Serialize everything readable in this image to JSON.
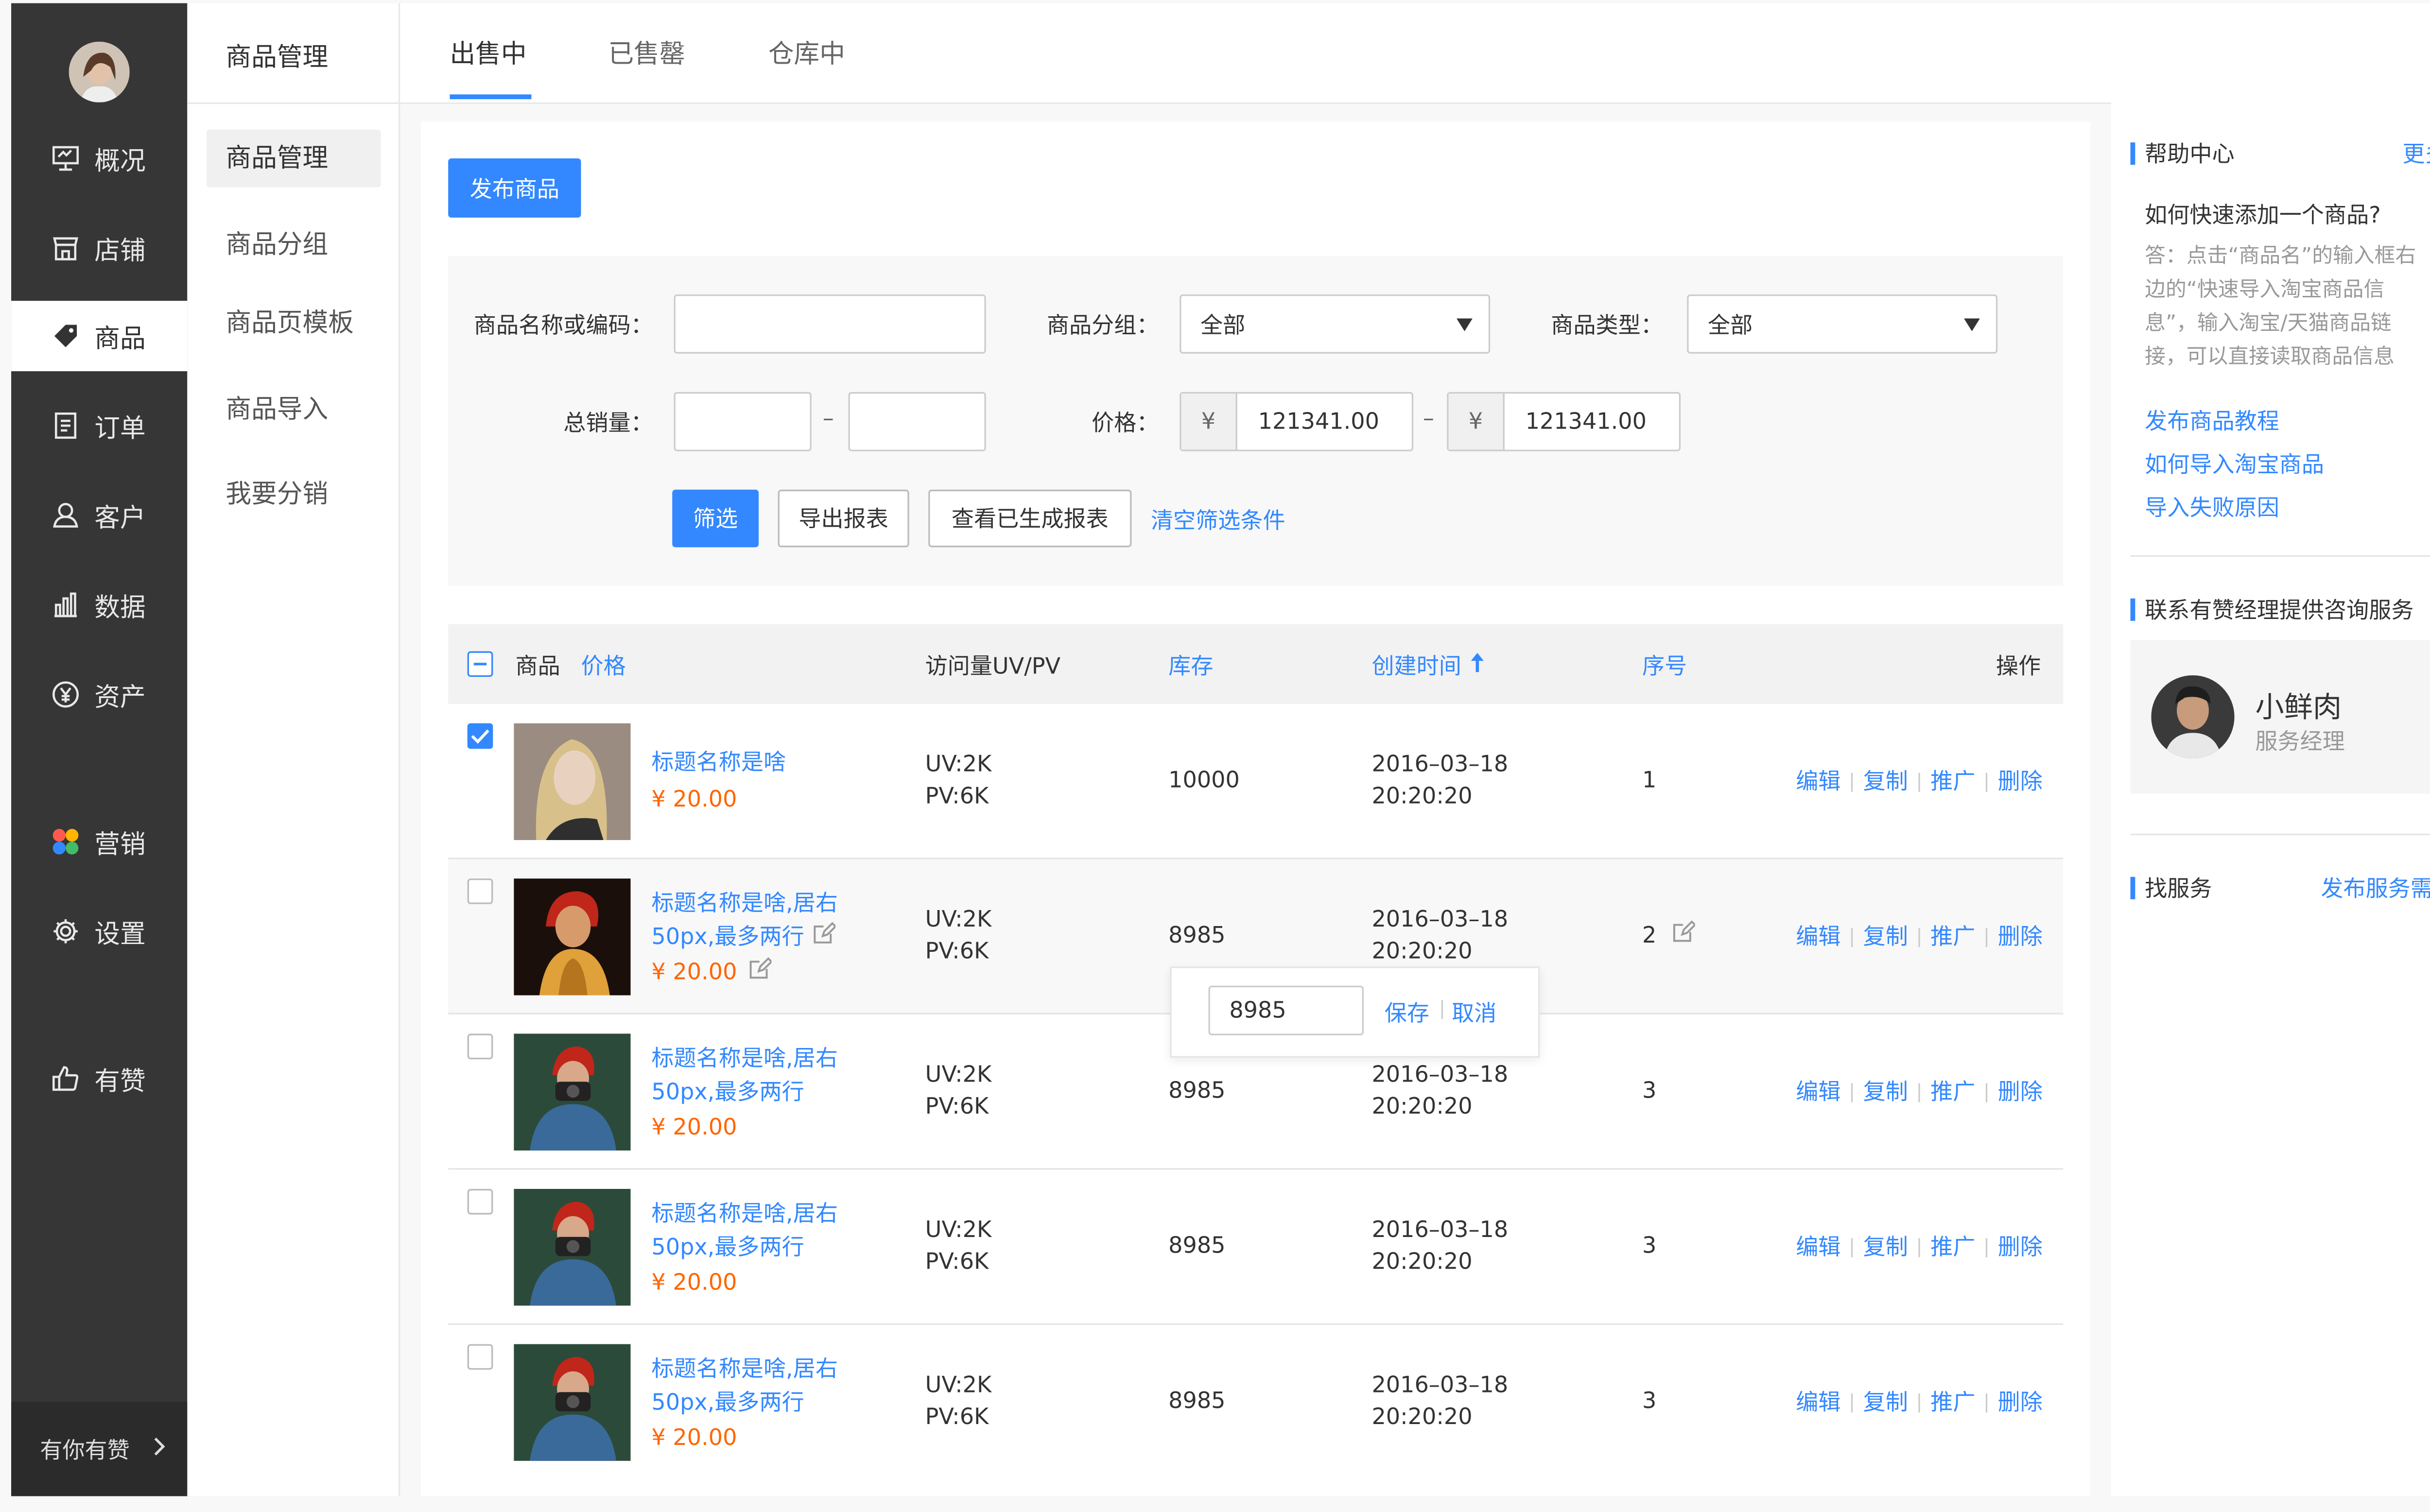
{
  "nav": {
    "items": [
      {
        "label": "概况",
        "icon": "dashboard-icon"
      },
      {
        "label": "店铺",
        "icon": "shop-icon"
      },
      {
        "label": "商品",
        "icon": "tag-icon"
      },
      {
        "label": "订单",
        "icon": "order-icon"
      },
      {
        "label": "客户",
        "icon": "customer-icon"
      },
      {
        "label": "数据",
        "icon": "chart-icon"
      },
      {
        "label": "资产",
        "icon": "yen-icon"
      },
      {
        "label": "营销",
        "icon": "marketing-icon"
      },
      {
        "label": "设置",
        "icon": "gear-icon"
      },
      {
        "label": "有赞",
        "icon": "thumbs-up-icon"
      }
    ],
    "bottom_label": "有你有赞",
    "bottom_icon": "chevron-right-icon"
  },
  "subnav": {
    "title": "商品管理",
    "items": [
      {
        "label": "商品管理"
      },
      {
        "label": "商品分组"
      },
      {
        "label": "商品页模板"
      },
      {
        "label": "商品导入"
      },
      {
        "label": "我要分销"
      }
    ]
  },
  "tabs": [
    {
      "label": "出售中"
    },
    {
      "label": "已售罄"
    },
    {
      "label": "仓库中"
    }
  ],
  "toolbar": {
    "publish_label": "发布商品"
  },
  "filter": {
    "name_label": "商品名称或编码：",
    "name_value": "",
    "group_label": "商品分组：",
    "group_value": "全部",
    "type_label": "商品类型：",
    "type_value": "全部",
    "sales_label": "总销量：",
    "sales_from": "",
    "sales_to": "",
    "range_sep": "–",
    "price_label": "价格：",
    "currency": "¥",
    "price_from": "121341.00",
    "price_to": "121341.00",
    "filter_btn": "筛选",
    "export_btn": "导出报表",
    "view_reports_btn": "查看已生成报表",
    "clear_link": "清空筛选条件"
  },
  "table": {
    "headers": {
      "product": "商品",
      "price": "价格",
      "visits": "访问量UV/PV",
      "stock": "库存",
      "created": "创建时间",
      "sort": "序号",
      "actions": "操作"
    },
    "actions": [
      "编辑",
      "复制",
      "推广",
      "删除"
    ],
    "rows": [
      {
        "checked": true,
        "title1": "标题名称是啥",
        "title2": "",
        "price": "¥ 20.00",
        "uv": "UV:2K",
        "pv": "PV:6K",
        "stock": "10000",
        "date": "2016–03–18",
        "time": "20:20:20",
        "sort": "1"
      },
      {
        "checked": false,
        "title1": "标题名称是啥,居右",
        "title2": "50px,最多两行",
        "price": "¥ 20.00",
        "uv": "UV:2K",
        "pv": "PV:6K",
        "stock": "8985",
        "date": "2016–03–18",
        "time": "20:20:20",
        "sort": "2"
      },
      {
        "checked": false,
        "title1": "标题名称是啥,居右",
        "title2": "50px,最多两行",
        "price": "¥ 20.00",
        "uv": "UV:2K",
        "pv": "PV:6K",
        "stock": "8985",
        "date": "2016–03–18",
        "time": "20:20:20",
        "sort": "3"
      },
      {
        "checked": false,
        "title1": "标题名称是啥,居右",
        "title2": "50px,最多两行",
        "price": "¥ 20.00",
        "uv": "UV:2K",
        "pv": "PV:6K",
        "stock": "8985",
        "date": "2016–03–18",
        "time": "20:20:20",
        "sort": "3"
      },
      {
        "checked": false,
        "title1": "标题名称是啥,居右",
        "title2": "50px,最多两行",
        "price": "¥ 20.00",
        "uv": "UV:2K",
        "pv": "PV:6K",
        "stock": "8985",
        "date": "2016–03–18",
        "time": "20:20:20",
        "sort": "3"
      }
    ]
  },
  "stock_editor": {
    "value": "8985",
    "save": "保存",
    "cancel": "取消"
  },
  "help": {
    "title": "帮助中心",
    "more": "更多",
    "question": "如何快速添加一个商品?",
    "answer_lines": [
      "答：点击“商品名”的输入框右",
      "边的“快速导入淘宝商品信",
      "息”，输入淘宝/天猫商品链",
      "接，可以直接读取商品信息"
    ],
    "links": [
      "发布商品教程",
      "如何导入淘宝商品",
      "导入失败原因"
    ]
  },
  "manager": {
    "title": "联系有赞经理提供咨询服务",
    "name": "小鲜肉",
    "role": "服务经理"
  },
  "service": {
    "title": "找服务",
    "link": "发布服务需求"
  },
  "colors": {
    "accent": "#3388ff",
    "price": "#ff6600",
    "nav_bg": "#363636"
  }
}
